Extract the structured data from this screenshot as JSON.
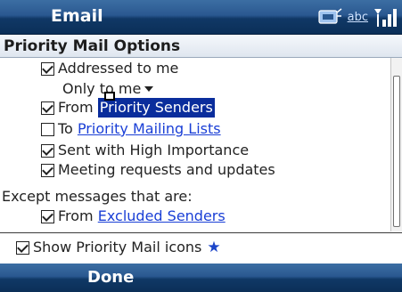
{
  "titlebar": {
    "title": "Email",
    "abc_label": "abc"
  },
  "section": {
    "title": "Priority Mail Options"
  },
  "options": {
    "addressed": {
      "label": "Addressed to me",
      "checked": true
    },
    "only_to_me": {
      "label": "Only to me"
    },
    "from_priority": {
      "prefix": "From",
      "link": "Priority Senders",
      "checked": true
    },
    "to_priority": {
      "prefix": "To",
      "link": "Priority Mailing Lists",
      "checked": false
    },
    "high_importance": {
      "label": "Sent with High Importance",
      "checked": true
    },
    "meeting_requests": {
      "label": "Meeting requests and updates",
      "checked": true
    },
    "except_label": "Except messages that are:",
    "from_excluded": {
      "prefix": "From",
      "link": "Excluded Senders",
      "checked": true
    }
  },
  "show_icons": {
    "label": "Show Priority Mail icons",
    "checked": true
  },
  "softkeys": {
    "left": "Done"
  },
  "colors": {
    "bar": "#0b2f58",
    "link": "#1a3fd6",
    "selection": "#0a2d9c"
  }
}
